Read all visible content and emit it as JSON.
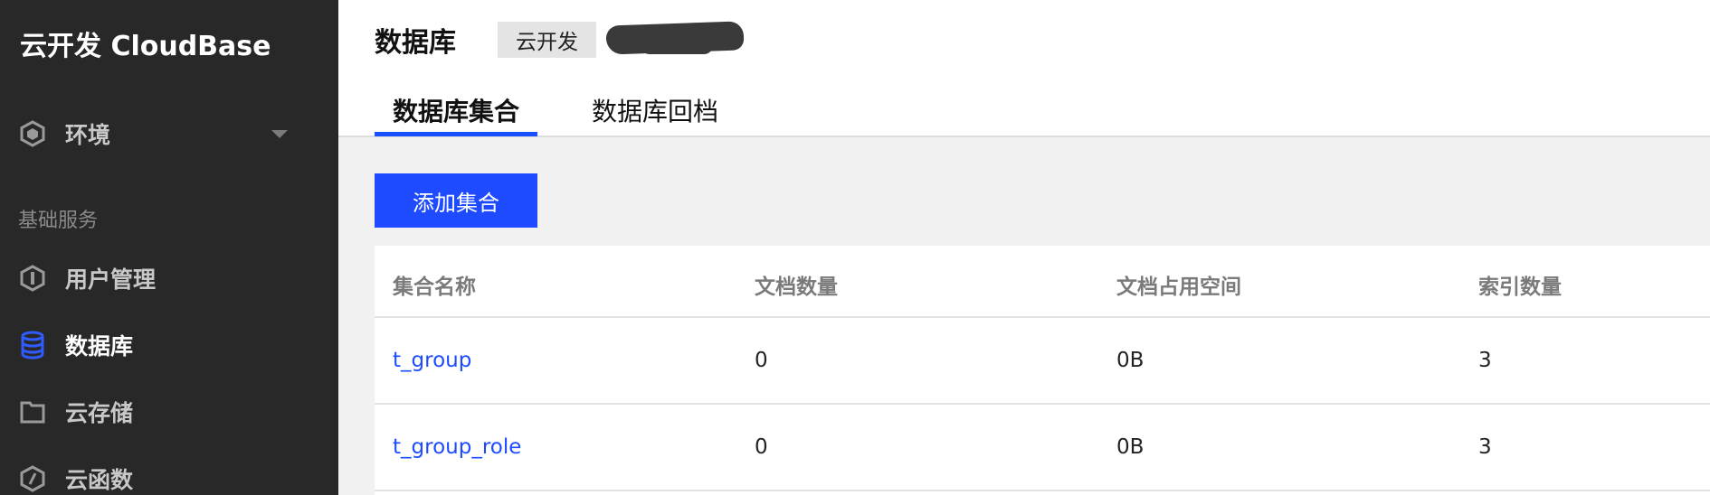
{
  "sidebar": {
    "brand": "云开发 CloudBase",
    "env": {
      "label": "环境",
      "icon": "hexagon-icon"
    },
    "section_title": "基础服务",
    "items": [
      {
        "label": "用户管理",
        "icon": "user-shield-icon",
        "active": false
      },
      {
        "label": "数据库",
        "icon": "database-icon",
        "active": true
      },
      {
        "label": "云存储",
        "icon": "folder-icon",
        "active": false
      },
      {
        "label": "云函数",
        "icon": "function-icon",
        "active": false
      }
    ]
  },
  "header": {
    "title": "数据库",
    "env_chip": "云开发"
  },
  "tabs": [
    {
      "label": "数据库集合",
      "active": true
    },
    {
      "label": "数据库回档",
      "active": false
    }
  ],
  "actions": {
    "add_collection": "添加集合"
  },
  "table": {
    "columns": [
      "集合名称",
      "文档数量",
      "文档占用空间",
      "索引数量"
    ],
    "rows": [
      {
        "name": "t_group",
        "doc_count": "0",
        "size": "0B",
        "index_count": "3"
      },
      {
        "name": "t_group_role",
        "doc_count": "0",
        "size": "0B",
        "index_count": "3"
      }
    ]
  },
  "colors": {
    "sidebar_bg": "#282828",
    "accent": "#1e4bff",
    "link": "#1e4bff"
  }
}
